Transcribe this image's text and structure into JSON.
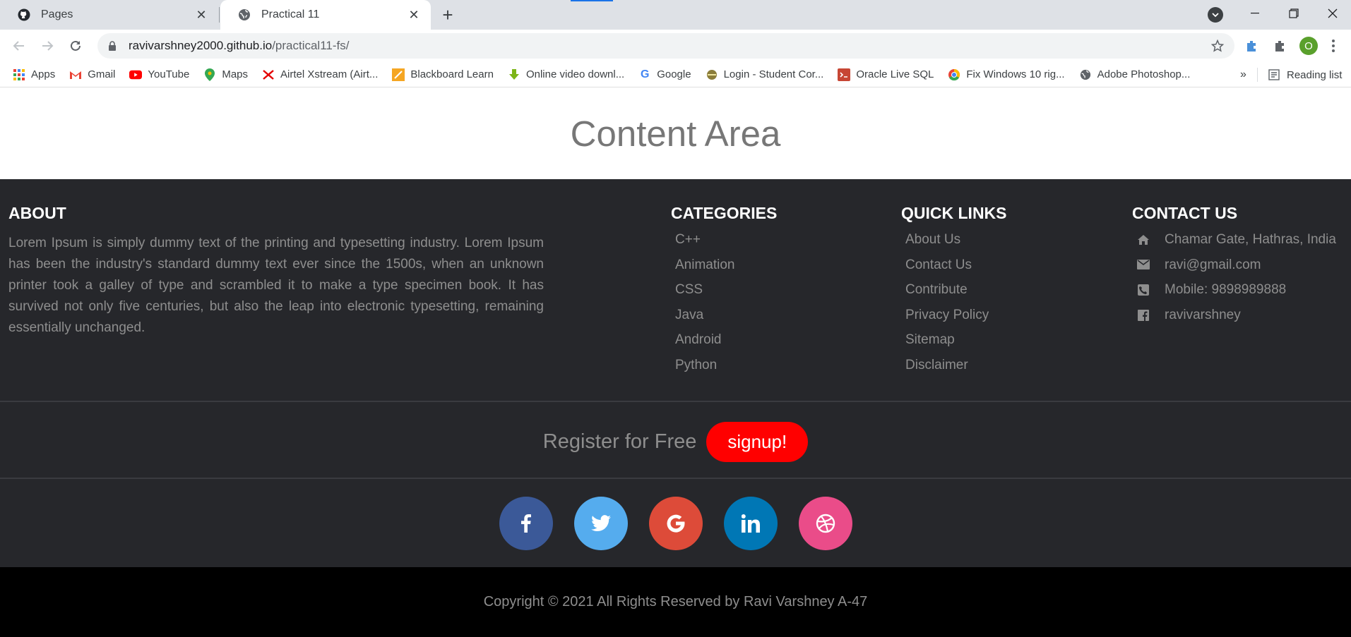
{
  "browser": {
    "tabs": [
      {
        "title": "Pages",
        "icon": "github-icon",
        "active": false
      },
      {
        "title": "Practical 11",
        "icon": "globe-icon",
        "active": true
      }
    ],
    "new_tab": "+",
    "url_host": "ravivarshney2000.github.io",
    "url_path": "/practical11-fs/",
    "profile_initial": "O",
    "bookmarks": [
      {
        "label": "Apps",
        "icon": "apps-grid-icon"
      },
      {
        "label": "Gmail",
        "icon": "gmail-icon"
      },
      {
        "label": "YouTube",
        "icon": "youtube-icon"
      },
      {
        "label": "Maps",
        "icon": "maps-icon"
      },
      {
        "label": "Airtel Xstream (Airt...",
        "icon": "airtel-icon"
      },
      {
        "label": "Blackboard Learn",
        "icon": "blackboard-icon"
      },
      {
        "label": "Online video downl...",
        "icon": "download-icon"
      },
      {
        "label": "Google",
        "icon": "google-icon"
      },
      {
        "label": "Login - Student Cor...",
        "icon": "student-icon"
      },
      {
        "label": "Oracle Live SQL",
        "icon": "oracle-icon"
      },
      {
        "label": "Fix Windows 10 rig...",
        "icon": "chrome-icon"
      },
      {
        "label": "Adobe Photoshop...",
        "icon": "globe-icon"
      }
    ],
    "bookmarks_more": "»",
    "reading_list": "Reading list"
  },
  "page": {
    "content_title": "Content Area",
    "about": {
      "title": "ABOUT",
      "text": "Lorem Ipsum is simply dummy text of the printing and typesetting industry. Lorem Ipsum has been the industry's standard dummy text ever since the 1500s, when an unknown printer took a galley of type and scrambled it to make a type specimen book. It has survived not only five centuries, but also the leap into electronic typesetting, remaining essentially unchanged."
    },
    "categories": {
      "title": "CATEGORIES",
      "items": [
        "C++",
        "Animation",
        "CSS",
        "Java",
        "Android",
        "Python"
      ]
    },
    "quick_links": {
      "title": "QUICK LINKS",
      "items": [
        "About Us",
        "Contact Us",
        "Contribute",
        "Privacy Policy",
        "Sitemap",
        "Disclaimer"
      ]
    },
    "contact": {
      "title": "CONTACT US",
      "items": [
        {
          "icon": "home-icon",
          "text": "Chamar Gate, Hathras, India"
        },
        {
          "icon": "envelope-icon",
          "text": "ravi@gmail.com"
        },
        {
          "icon": "phone-icon",
          "text": "Mobile: 9898989888"
        },
        {
          "icon": "facebook-square-icon",
          "text": "ravivarshney"
        }
      ]
    },
    "register": {
      "label": "Register for Free",
      "button": "signup!"
    },
    "socials": [
      {
        "name": "facebook",
        "color": "#3b5998"
      },
      {
        "name": "twitter",
        "color": "#55acee"
      },
      {
        "name": "google",
        "color": "#dd4b39"
      },
      {
        "name": "linkedin",
        "color": "#0077b5"
      },
      {
        "name": "dribbble",
        "color": "#ea4c89"
      }
    ],
    "copyright": "Copyright © 2021 All Rights Reserved by Ravi Varshney A-47"
  }
}
